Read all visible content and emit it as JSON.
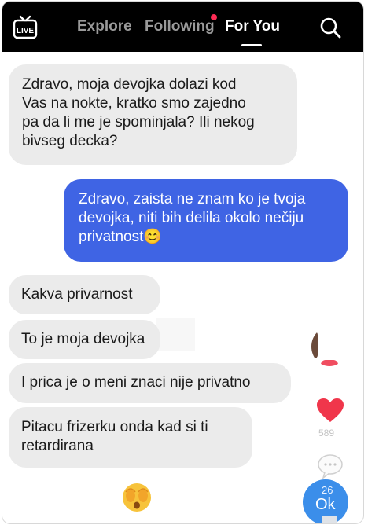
{
  "topbar": {
    "live_icon": "live-tv-icon",
    "live_label": "LIVE",
    "tabs": [
      {
        "label": "Explore",
        "active": false
      },
      {
        "label": "Following",
        "active": false,
        "has_notification_dot": true
      },
      {
        "label": "For You",
        "active": true
      }
    ],
    "search_icon": "search-icon"
  },
  "messages": [
    {
      "from": "other",
      "text": "Zdravo, moja devojka dolazi kod\nVas na nokte, kratko smo zajedno\npa da li me je spominjala? Ili nekog\nbivseg decka?"
    },
    {
      "from": "me",
      "text": "Zdravo, zaista ne znam ko je tvoja\ndevojka, niti bih delila okolo nečiju\nprivatnost😊"
    },
    {
      "from": "other",
      "text": "Kakva privarnost"
    },
    {
      "from": "other",
      "text": "To je moja devojka"
    },
    {
      "from": "other",
      "text": "I prica je o meni znaci nije privatno"
    },
    {
      "from": "other",
      "text": "Pitacu frizerku onda kad si ti\nretardirana"
    }
  ],
  "reaction_emoji": "face-with-hands-over-eyes-emoji",
  "side_actions": {
    "avatar_icon": "creator-avatar",
    "like_icon": "heart-icon",
    "like_count": "589",
    "comment_icon": "comment-bubble-icon",
    "ok_badge": {
      "count": "26",
      "label": "Ok"
    }
  },
  "colors": {
    "topbar_bg": "#000000",
    "received_bubble": "#ebebeb",
    "sent_bubble": "#3f64e4",
    "like_red": "#f0364b",
    "notification_dot": "#fe2c55",
    "ok_blue": "#3b8eea"
  }
}
